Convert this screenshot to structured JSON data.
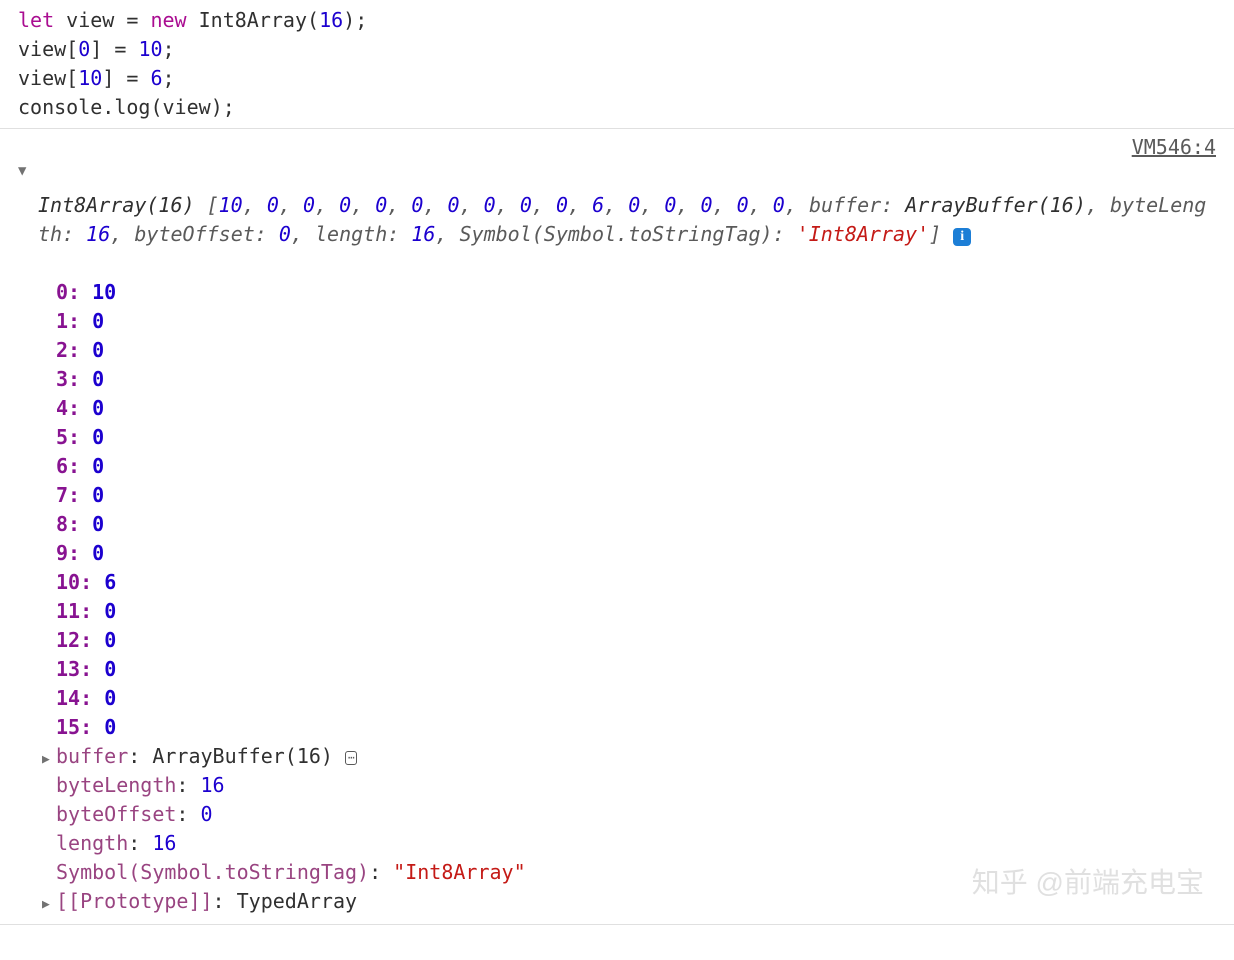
{
  "code": {
    "keyword_let": "let",
    "var_view": "view",
    "eq": " = ",
    "keyword_new": "new",
    "type": "Int8Array",
    "arg": "16",
    "l2_target": "view",
    "l2_idx": "0",
    "l2_val": "10",
    "l3_target": "view",
    "l3_idx": "10",
    "l3_val": "6",
    "l4_obj": "console",
    "l4_method": "log",
    "l4_arg": "view"
  },
  "source_link": "VM546:4",
  "summary": {
    "type": "Int8Array(16)",
    "open_br": " [",
    "values": [
      "10",
      "0",
      "0",
      "0",
      "0",
      "0",
      "0",
      "0",
      "0",
      "0",
      "6",
      "0",
      "0",
      "0",
      "0",
      "0"
    ],
    "sep": ", ",
    "tail1_k": "buffer: ",
    "tail1_v": "ArrayBuffer(16)",
    "tail2_k": "byteLength: ",
    "tail2_v": "16",
    "tail3_k": "byteOffset: ",
    "tail3_v": "0",
    "tail4_k": "length: ",
    "tail4_v": "16",
    "tail5_k": "Symbol(Symbol.toStringTag): ",
    "tail5_v": "'Int8Array'",
    "close_br": "]"
  },
  "entries": [
    {
      "k": "0",
      "v": "10"
    },
    {
      "k": "1",
      "v": "0"
    },
    {
      "k": "2",
      "v": "0"
    },
    {
      "k": "3",
      "v": "0"
    },
    {
      "k": "4",
      "v": "0"
    },
    {
      "k": "5",
      "v": "0"
    },
    {
      "k": "6",
      "v": "0"
    },
    {
      "k": "7",
      "v": "0"
    },
    {
      "k": "8",
      "v": "0"
    },
    {
      "k": "9",
      "v": "0"
    },
    {
      "k": "10",
      "v": "6"
    },
    {
      "k": "11",
      "v": "0"
    },
    {
      "k": "12",
      "v": "0"
    },
    {
      "k": "13",
      "v": "0"
    },
    {
      "k": "14",
      "v": "0"
    },
    {
      "k": "15",
      "v": "0"
    }
  ],
  "props": {
    "buffer_k": "buffer",
    "buffer_v": "ArrayBuffer(16)",
    "byteLength_k": "byteLength",
    "byteLength_v": "16",
    "byteOffset_k": "byteOffset",
    "byteOffset_v": "0",
    "length_k": "length",
    "length_v": "16",
    "symtag_k": "Symbol(Symbol.toStringTag)",
    "symtag_v": "\"Int8Array\"",
    "proto_k": "[[Prototype]]",
    "proto_v": "TypedArray"
  },
  "info_glyph": "i",
  "inspect_glyph": "⋯",
  "watermark": "知乎 @前端充电宝"
}
